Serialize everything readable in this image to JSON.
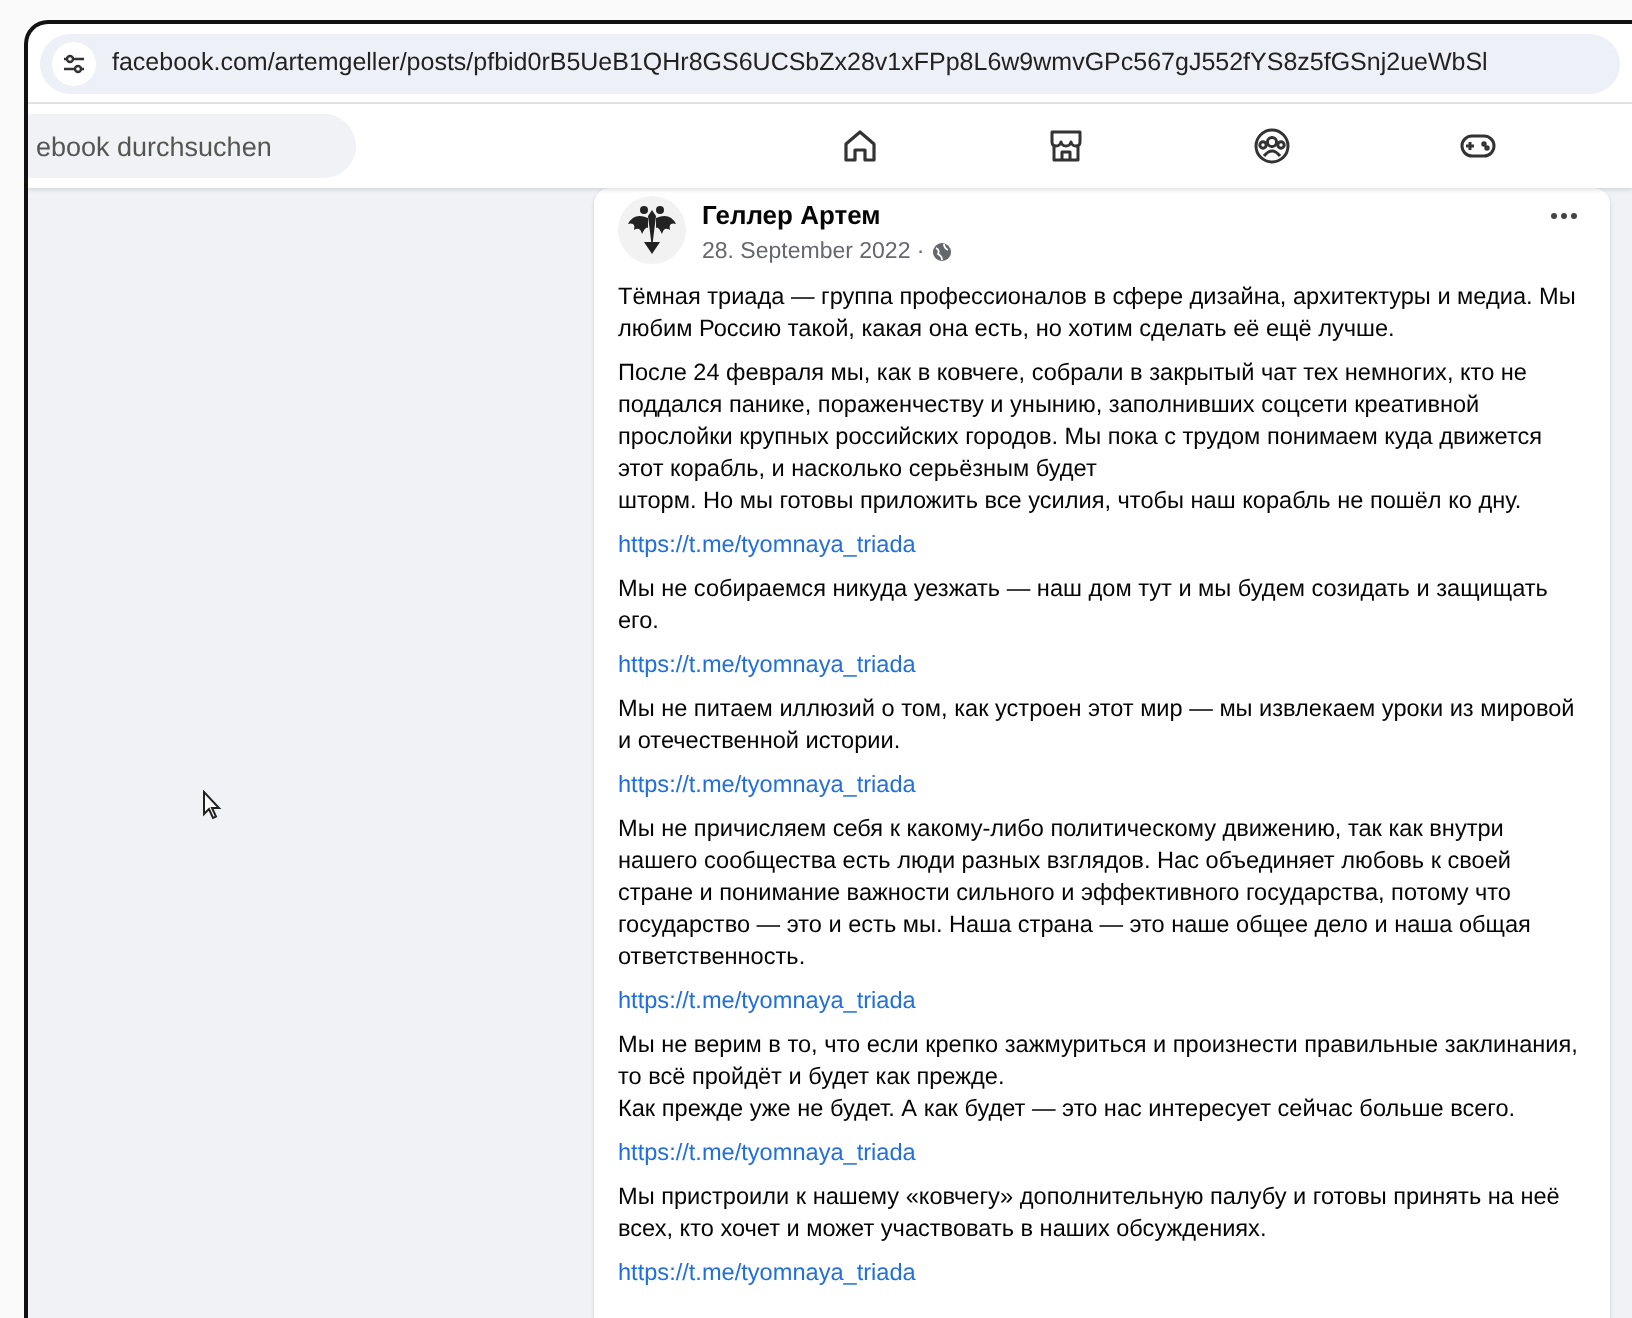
{
  "address_bar": {
    "url": "facebook.com/artemgeller/posts/pfbid0rB5UeB1QHr8GS6UCSbZx28v1xFPp8L6w9wmvGPc567gJ552fYS8z5fGSnj2ueWbSl"
  },
  "navbar": {
    "search": {
      "placeholder": "ebook durchsuchen"
    },
    "tabs": [
      {
        "kind": "home"
      },
      {
        "kind": "marketplace"
      },
      {
        "kind": "groups"
      },
      {
        "kind": "gaming"
      }
    ]
  },
  "post": {
    "author": "Геллер Артем",
    "date": "28. September 2022 ·",
    "blocks": [
      {
        "kind": "text",
        "text": "Тёмная триада — группа профессионалов в сфере дизайна, архитектуры и медиа. Мы любим Россию такой, какая она есть, но хотим сделать её ещё лучше."
      },
      {
        "kind": "text",
        "text": "После 24 февраля мы, как в ковчеге, собрали в закрытый чат тех немногих, кто не поддался панике, пораженчеству и унынию, заполнивших соцсети креативной прослойки крупных российских городов. Мы пока с трудом понимаем куда движется этот корабль, и насколько серьёзным будет\nшторм. Но мы готовы приложить все усилия, чтобы наш корабль не пошёл ко дну."
      },
      {
        "kind": "link",
        "text": "https://t.me/tyomnaya_triada"
      },
      {
        "kind": "text",
        "text": "Мы не собираемся никуда уезжать — наш дом тут и мы будем созидать и защищать его."
      },
      {
        "kind": "link",
        "text": "https://t.me/tyomnaya_triada"
      },
      {
        "kind": "text",
        "text": "Мы не питаем иллюзий о том, как устроен этот мир — мы извлекаем уроки из мировой и отечественной истории."
      },
      {
        "kind": "link",
        "text": "https://t.me/tyomnaya_triada"
      },
      {
        "kind": "text",
        "text": "Мы не причисляем себя к какому-либо политическому движению, так как внутри нашего сообщества есть люди разных взглядов. Нас объединяет любовь к своей стране и понимание важности сильного и эффективного государства, потому что государство — это и есть мы. Наша страна — это наше общее дело и наша общая ответственность."
      },
      {
        "kind": "link",
        "text": "https://t.me/tyomnaya_triada"
      },
      {
        "kind": "text",
        "text": "Мы не верим в то, что если крепко зажмуриться и произнести правильные заклинания, то всё пройдёт и будет как прежде.\nКак прежде уже не будет. А как будет — это нас интересует сейчас больше всего."
      },
      {
        "kind": "link",
        "text": "https://t.me/tyomnaya_triada"
      },
      {
        "kind": "text",
        "text": "Мы пристроили к нашему «ковчегу» дополнительную палубу и готовы принять на неё всех, кто хочет и может участвовать в наших обсуждениях."
      },
      {
        "kind": "link",
        "text": "https://t.me/tyomnaya_triada"
      }
    ]
  }
}
